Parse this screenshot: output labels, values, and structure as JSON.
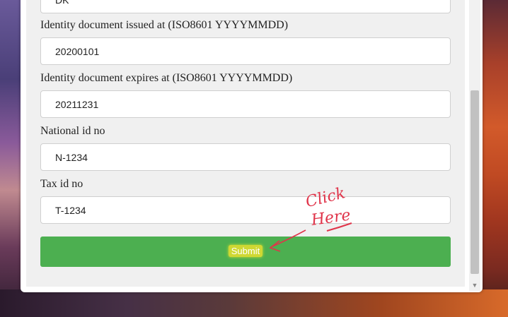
{
  "fields": [
    {
      "label": "Identity document issued at (ISO8601 YYYYMMDD)",
      "value": "20200101"
    },
    {
      "label": "Identity document expires at (ISO8601 YYYYMMDD)",
      "value": "20211231"
    },
    {
      "label": "National id no",
      "value": "N-1234"
    },
    {
      "label": "Tax id no",
      "value": "T-1234"
    }
  ],
  "partial_field_value": "DK",
  "submit_label": "Submit",
  "annotation": {
    "line1": "Click",
    "line2": "Here",
    "color": "#e0344a"
  },
  "colors": {
    "submit": "#4caf50",
    "highlight": "#cfd833"
  },
  "icons": {
    "scroll_down": "arrow-down-icon"
  }
}
